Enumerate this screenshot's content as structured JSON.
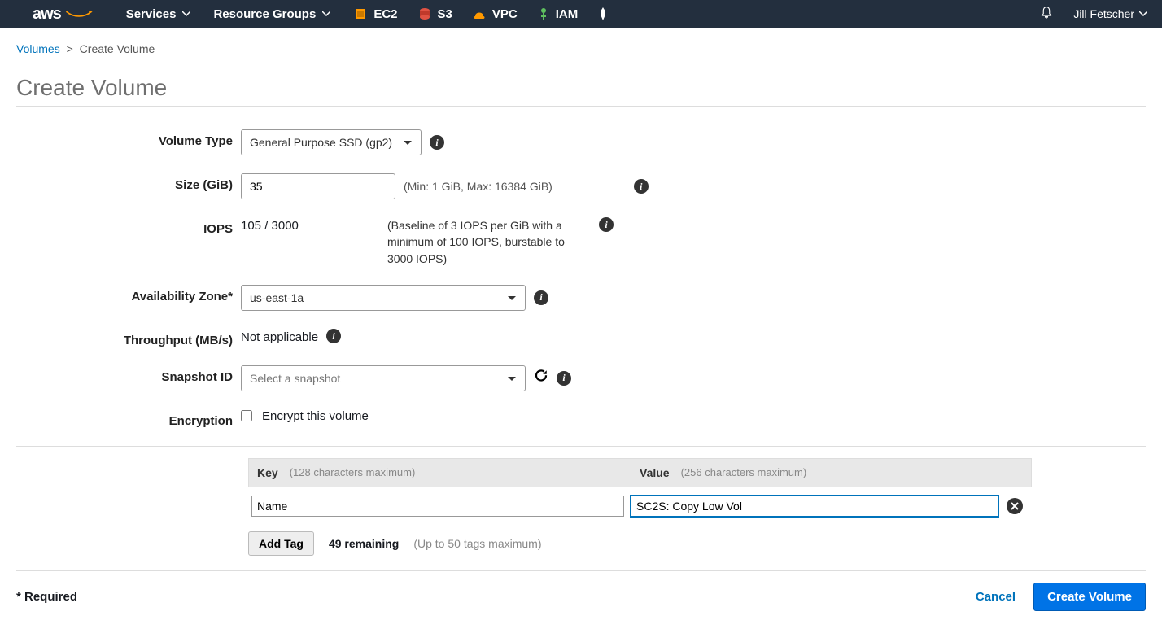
{
  "nav": {
    "logo": "aws",
    "services": "Services",
    "resource_groups": "Resource Groups",
    "shortcuts": [
      {
        "label": "EC2",
        "icon": "ec2"
      },
      {
        "label": "S3",
        "icon": "s3"
      },
      {
        "label": "VPC",
        "icon": "vpc"
      },
      {
        "label": "IAM",
        "icon": "iam"
      }
    ],
    "user": "Jill Fetscher"
  },
  "breadcrumb": {
    "volumes": "Volumes",
    "current": "Create Volume"
  },
  "title": "Create Volume",
  "form": {
    "volume_type": {
      "label": "Volume Type",
      "value": "General Purpose SSD (gp2)"
    },
    "size": {
      "label": "Size (GiB)",
      "value": "35",
      "hint": "(Min: 1 GiB, Max: 16384 GiB)"
    },
    "iops": {
      "label": "IOPS",
      "value": "105 / 3000",
      "hint": "(Baseline of 3 IOPS per GiB with a minimum of 100 IOPS, burstable to 3000 IOPS)"
    },
    "az": {
      "label": "Availability Zone*",
      "value": "us-east-1a"
    },
    "throughput": {
      "label": "Throughput (MB/s)",
      "value": "Not applicable"
    },
    "snapshot": {
      "label": "Snapshot ID",
      "placeholder": "Select a snapshot"
    },
    "encryption": {
      "label": "Encryption",
      "checkbox_label": "Encrypt this volume"
    }
  },
  "tags": {
    "headers": {
      "key": "Key",
      "key_hint": "(128 characters maximum)",
      "value": "Value",
      "value_hint": "(256 characters maximum)"
    },
    "row": {
      "key": "Name",
      "value": "SC2S: Copy Low Vol"
    },
    "add_tag": "Add Tag",
    "remaining": "49 remaining",
    "max_hint": "(Up to 50 tags maximum)"
  },
  "footer": {
    "required": "* Required",
    "cancel": "Cancel",
    "create": "Create Volume"
  }
}
